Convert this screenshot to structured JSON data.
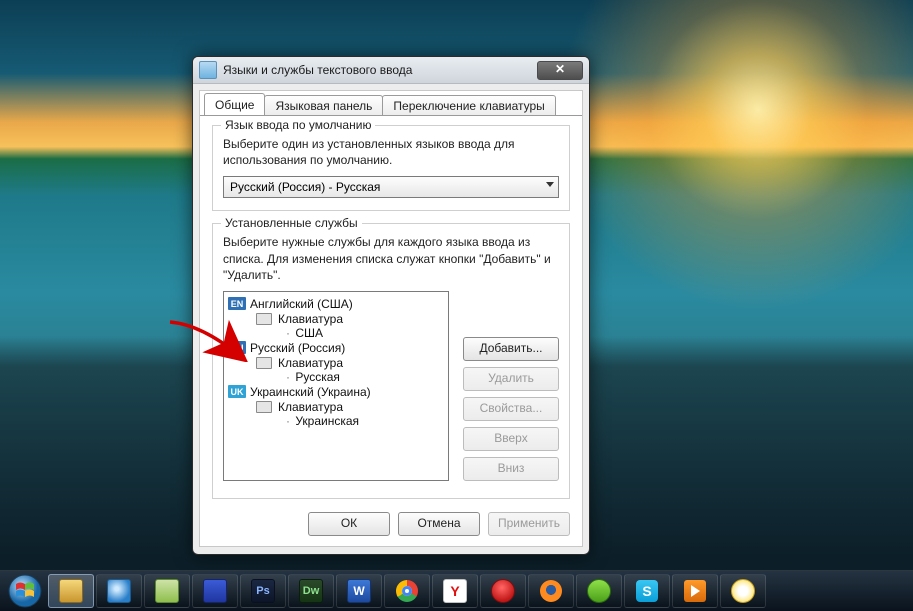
{
  "window": {
    "title": "Языки и службы текстового ввода",
    "tabs": {
      "general": "Общие",
      "langbar": "Языковая панель",
      "switch": "Переключение клавиатуры"
    },
    "default_group": {
      "legend": "Язык ввода по умолчанию",
      "desc": "Выберите один из установленных языков ввода для использования по умолчанию.",
      "combo_value": "Русский (Россия) - Русская"
    },
    "installed_group": {
      "legend": "Установленные службы",
      "desc": "Выберите нужные службы для каждого языка ввода из списка. Для изменения списка служат кнопки \"Добавить\" и \"Удалить\".",
      "buttons": {
        "add": "Добавить...",
        "remove": "Удалить",
        "properties": "Свойства...",
        "up": "Вверх",
        "down": "Вниз"
      },
      "tree": [
        {
          "code": "EN",
          "cls": "en",
          "name": "Английский (США)",
          "kb": "Клавиатура",
          "layout": "США"
        },
        {
          "code": "RU",
          "cls": "ru",
          "name": "Русский (Россия)",
          "kb": "Клавиатура",
          "layout": "Русская"
        },
        {
          "code": "UK",
          "cls": "uk",
          "name": "Украинский (Украина)",
          "kb": "Клавиатура",
          "layout": "Украинская"
        }
      ]
    },
    "dialog_buttons": {
      "ok": "ОК",
      "cancel": "Отмена",
      "apply": "Применить"
    }
  },
  "taskbar": {
    "items": [
      {
        "name": "start",
        "cls": "start"
      },
      {
        "name": "explorer",
        "cls": "explorer"
      },
      {
        "name": "internet-explorer",
        "cls": "ie"
      },
      {
        "name": "notepad",
        "cls": "notepad"
      },
      {
        "name": "save-floppy",
        "cls": "save"
      },
      {
        "name": "photoshop",
        "cls": "ps",
        "glyph": "Ps"
      },
      {
        "name": "dreamweaver",
        "cls": "dw",
        "glyph": "Dw"
      },
      {
        "name": "word",
        "cls": "word",
        "glyph": "W"
      },
      {
        "name": "chrome",
        "cls": "chrome"
      },
      {
        "name": "yandex",
        "cls": "yandex",
        "glyph": "Y"
      },
      {
        "name": "opera",
        "cls": "opera"
      },
      {
        "name": "firefox",
        "cls": "firefox"
      },
      {
        "name": "icq",
        "cls": "icq"
      },
      {
        "name": "skype",
        "cls": "skype",
        "glyph": "S"
      },
      {
        "name": "media-player",
        "cls": "wmp"
      },
      {
        "name": "qip",
        "cls": "qip"
      }
    ]
  }
}
